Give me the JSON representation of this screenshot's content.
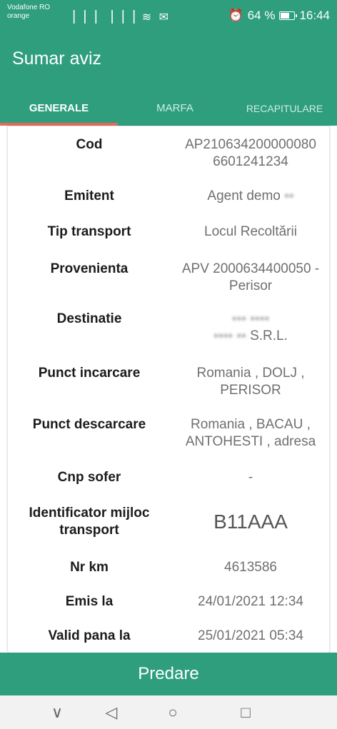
{
  "status_bar": {
    "carrier_line1": "Vodafone RO",
    "carrier_line2": "orange",
    "signal_icons": "▕▕▕ ▕▕▕ ≋ ✉",
    "alarm_icon": "⏰",
    "battery_text": "64 %",
    "battery_level": 0.64,
    "time": "16:44"
  },
  "app_bar": {
    "title": "Sumar aviz",
    "tabs": [
      {
        "label": "GENERALE",
        "active": true
      },
      {
        "label": "MARFA",
        "active": false
      },
      {
        "label": "RECAPITULARE",
        "active": false
      }
    ]
  },
  "details": [
    {
      "label": "Cod",
      "value": "AP210634200000080\n6601241234"
    },
    {
      "label": "Emitent",
      "value": "Agent demo"
    },
    {
      "label": "Tip transport",
      "value": "Locul Recoltării"
    },
    {
      "label": "Provenienta",
      "value": "APV 2000634400050 -\nPerisor"
    },
    {
      "label": "Destinatie",
      "value": "S.R.L."
    },
    {
      "label": "Punct incarcare",
      "value": "Romania , DOLJ ,\nPERISOR"
    },
    {
      "label": "Punct descarcare",
      "value": "Romania , BACAU ,\nANTOHESTI , adresa"
    },
    {
      "label": "Cnp sofer",
      "value": "-"
    },
    {
      "label": "Identificator mijloc\ntransport",
      "value": "B11AAA"
    },
    {
      "label": "Nr km",
      "value": "4613586"
    },
    {
      "label": "Emis la",
      "value": "24/01/2021 12:34"
    },
    {
      "label": "Valid pana la",
      "value": "25/01/2021 05:34"
    }
  ],
  "footer": {
    "button_label": "Predare"
  },
  "nav_bar": {
    "back_icon": "◁",
    "home_icon": "○",
    "recent_icon": "□",
    "collapse_icon": "∨"
  },
  "colors": {
    "primary": "#2e9e7d",
    "tab_indicator": "#e36a5a"
  }
}
